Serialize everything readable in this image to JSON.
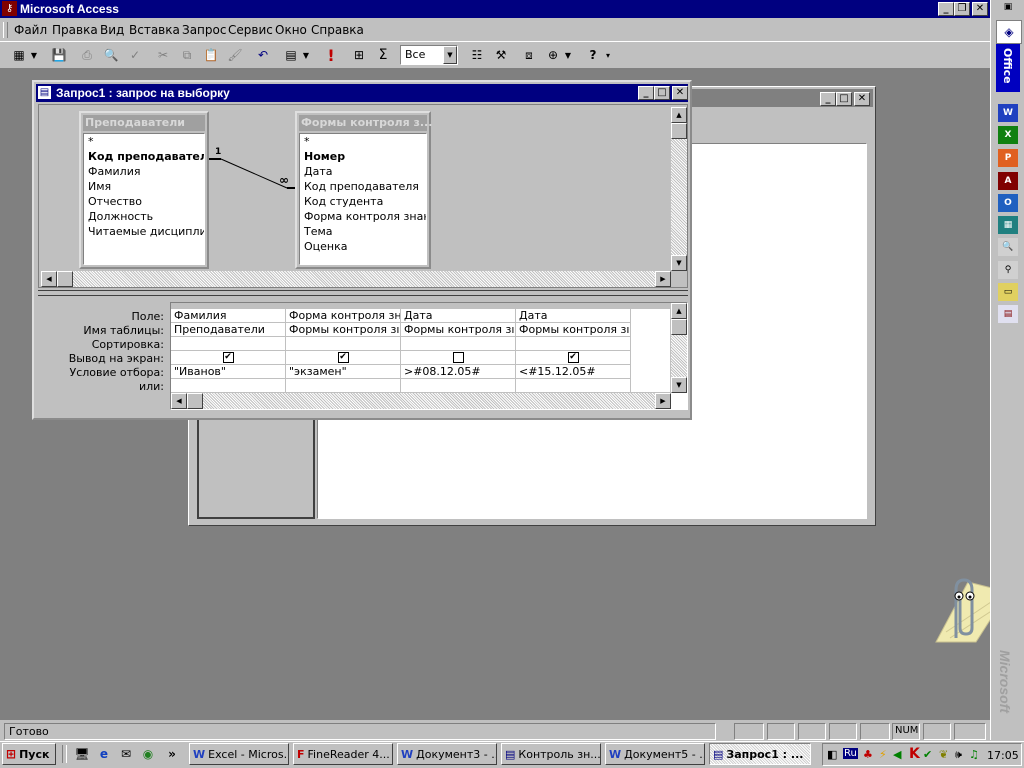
{
  "app": {
    "title": "Microsoft Access",
    "menu": [
      "Файл",
      "Правка",
      "Вид",
      "Вставка",
      "Запрос",
      "Сервис",
      "Окно",
      "Справка"
    ],
    "toolbar_combo": "Все",
    "status": "Готово",
    "num_indicator": "NUM"
  },
  "query_window": {
    "title": "Запрос1 : запрос на выборку",
    "tables": [
      {
        "name": "Преподаватели",
        "fields": [
          "*",
          "Код преподавателя",
          "Фамилия",
          "Имя",
          "Отчество",
          "Должность",
          "Читаемые дисциплины"
        ]
      },
      {
        "name": "Формы контроля з...",
        "fields": [
          "*",
          "Номер",
          "Дата",
          "Код преподавателя",
          "Код студента",
          "Форма контроля знаний",
          "Тема",
          "Оценка"
        ]
      }
    ],
    "join": {
      "one": "1",
      "many": "∞"
    },
    "grid_labels": [
      "Поле:",
      "Имя таблицы:",
      "Сортировка:",
      "Вывод на экран:",
      "Условие отбора:",
      "или:"
    ],
    "columns": [
      {
        "field": "Фамилия",
        "table": "Преподаватели",
        "sort": "",
        "show": true,
        "criteria": "\"Иванов\"",
        "or": ""
      },
      {
        "field": "Форма контроля зн",
        "table": "Формы контроля зı",
        "sort": "",
        "show": true,
        "criteria": "\"экзамен\"",
        "or": ""
      },
      {
        "field": "Дата",
        "table": "Формы контроля зı",
        "sort": "",
        "show": false,
        "criteria": ">#08.12.05#",
        "or": ""
      },
      {
        "field": "Дата",
        "table": "Формы контроля зı",
        "sort": "",
        "show": true,
        "criteria": "<#15.12.05#",
        "or": ""
      }
    ]
  },
  "office_bar": {
    "label": "Office",
    "brand": "Microsoft"
  },
  "taskbar": {
    "start": "Пуск",
    "tasks": [
      "Excel - Micros...",
      "FineReader 4...",
      "Документ3 - ...",
      "Контроль зн...",
      "Документ5 - ...",
      "Запрос1 : ..."
    ],
    "lang": "Ru",
    "clock": "17:05"
  },
  "colors": {
    "title_active": "#000080",
    "title_inactive": "#808080",
    "desktop": "#808080"
  }
}
